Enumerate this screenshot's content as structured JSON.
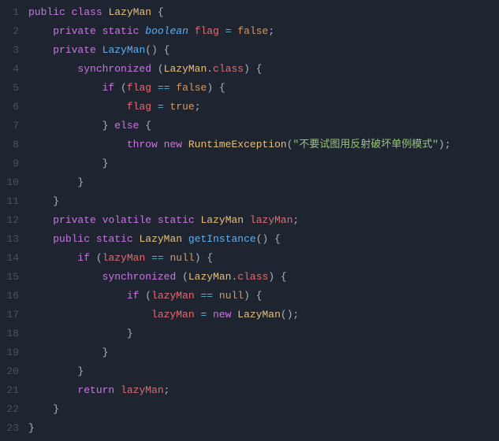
{
  "code": {
    "lines": [
      {
        "num": "1",
        "indent": 0,
        "tokens": [
          [
            "kw-mod",
            "public"
          ],
          [
            "sp",
            " "
          ],
          [
            "kw-mod",
            "class"
          ],
          [
            "sp",
            " "
          ],
          [
            "cls",
            "LazyMan"
          ],
          [
            "sp",
            " "
          ],
          [
            "punc",
            "{"
          ]
        ]
      },
      {
        "num": "2",
        "indent": 1,
        "tokens": [
          [
            "kw-mod",
            "private"
          ],
          [
            "sp",
            " "
          ],
          [
            "kw-mod",
            "static"
          ],
          [
            "sp",
            " "
          ],
          [
            "kw-type",
            "boolean"
          ],
          [
            "sp",
            " "
          ],
          [
            "id",
            "flag"
          ],
          [
            "sp",
            " "
          ],
          [
            "op",
            "="
          ],
          [
            "sp",
            " "
          ],
          [
            "kw-bool",
            "false"
          ],
          [
            "punc",
            ";"
          ]
        ]
      },
      {
        "num": "3",
        "indent": 1,
        "tokens": [
          [
            "kw-mod",
            "private"
          ],
          [
            "sp",
            " "
          ],
          [
            "fn",
            "LazyMan"
          ],
          [
            "punc",
            "()"
          ],
          [
            "sp",
            " "
          ],
          [
            "punc",
            "{"
          ]
        ]
      },
      {
        "num": "4",
        "indent": 2,
        "tokens": [
          [
            "kw-ctrl",
            "synchronized"
          ],
          [
            "sp",
            " "
          ],
          [
            "punc",
            "("
          ],
          [
            "cls",
            "LazyMan"
          ],
          [
            "punc",
            "."
          ],
          [
            "prop",
            "class"
          ],
          [
            "punc",
            ")"
          ],
          [
            "sp",
            " "
          ],
          [
            "punc",
            "{"
          ]
        ]
      },
      {
        "num": "5",
        "indent": 3,
        "tokens": [
          [
            "kw-ctrl",
            "if"
          ],
          [
            "sp",
            " "
          ],
          [
            "punc",
            "("
          ],
          [
            "id",
            "flag"
          ],
          [
            "sp",
            " "
          ],
          [
            "op",
            "=="
          ],
          [
            "sp",
            " "
          ],
          [
            "kw-bool",
            "false"
          ],
          [
            "punc",
            ")"
          ],
          [
            "sp",
            " "
          ],
          [
            "punc",
            "{"
          ]
        ]
      },
      {
        "num": "6",
        "indent": 4,
        "tokens": [
          [
            "id",
            "flag"
          ],
          [
            "sp",
            " "
          ],
          [
            "op",
            "="
          ],
          [
            "sp",
            " "
          ],
          [
            "kw-bool",
            "true"
          ],
          [
            "punc",
            ";"
          ]
        ]
      },
      {
        "num": "7",
        "indent": 3,
        "tokens": [
          [
            "punc",
            "}"
          ],
          [
            "sp",
            " "
          ],
          [
            "kw-ctrl",
            "else"
          ],
          [
            "sp",
            " "
          ],
          [
            "punc",
            "{"
          ]
        ]
      },
      {
        "num": "8",
        "indent": 4,
        "tokens": [
          [
            "kw-ctrl",
            "throw"
          ],
          [
            "sp",
            " "
          ],
          [
            "kw-new",
            "new"
          ],
          [
            "sp",
            " "
          ],
          [
            "cls",
            "RuntimeException"
          ],
          [
            "punc",
            "("
          ],
          [
            "str",
            "\"不要试图用反射破坏单例模式\""
          ],
          [
            "punc",
            ")"
          ],
          [
            "punc",
            ";"
          ]
        ]
      },
      {
        "num": "9",
        "indent": 3,
        "tokens": [
          [
            "punc",
            "}"
          ]
        ]
      },
      {
        "num": "10",
        "indent": 2,
        "tokens": [
          [
            "punc",
            "}"
          ]
        ]
      },
      {
        "num": "11",
        "indent": 1,
        "tokens": [
          [
            "punc",
            "}"
          ]
        ]
      },
      {
        "num": "12",
        "indent": 1,
        "tokens": [
          [
            "kw-mod",
            "private"
          ],
          [
            "sp",
            " "
          ],
          [
            "kw-mod",
            "volatile"
          ],
          [
            "sp",
            " "
          ],
          [
            "kw-mod",
            "static"
          ],
          [
            "sp",
            " "
          ],
          [
            "cls",
            "LazyMan"
          ],
          [
            "sp",
            " "
          ],
          [
            "id",
            "lazyMan"
          ],
          [
            "punc",
            ";"
          ]
        ]
      },
      {
        "num": "13",
        "indent": 1,
        "tokens": [
          [
            "kw-mod",
            "public"
          ],
          [
            "sp",
            " "
          ],
          [
            "kw-mod",
            "static"
          ],
          [
            "sp",
            " "
          ],
          [
            "cls",
            "LazyMan"
          ],
          [
            "sp",
            " "
          ],
          [
            "fn",
            "getInstance"
          ],
          [
            "punc",
            "()"
          ],
          [
            "sp",
            " "
          ],
          [
            "punc",
            "{"
          ]
        ]
      },
      {
        "num": "14",
        "indent": 2,
        "tokens": [
          [
            "kw-ctrl",
            "if"
          ],
          [
            "sp",
            " "
          ],
          [
            "punc",
            "("
          ],
          [
            "id",
            "lazyMan"
          ],
          [
            "sp",
            " "
          ],
          [
            "op",
            "=="
          ],
          [
            "sp",
            " "
          ],
          [
            "kw-bool",
            "null"
          ],
          [
            "punc",
            ")"
          ],
          [
            "sp",
            " "
          ],
          [
            "punc",
            "{"
          ]
        ]
      },
      {
        "num": "15",
        "indent": 3,
        "tokens": [
          [
            "kw-ctrl",
            "synchronized"
          ],
          [
            "sp",
            " "
          ],
          [
            "punc",
            "("
          ],
          [
            "cls",
            "LazyMan"
          ],
          [
            "punc",
            "."
          ],
          [
            "prop",
            "class"
          ],
          [
            "punc",
            ")"
          ],
          [
            "sp",
            " "
          ],
          [
            "punc",
            "{"
          ]
        ]
      },
      {
        "num": "16",
        "indent": 4,
        "tokens": [
          [
            "kw-ctrl",
            "if"
          ],
          [
            "sp",
            " "
          ],
          [
            "punc",
            "("
          ],
          [
            "id",
            "lazyMan"
          ],
          [
            "sp",
            " "
          ],
          [
            "op",
            "=="
          ],
          [
            "sp",
            " "
          ],
          [
            "kw-bool",
            "null"
          ],
          [
            "punc",
            ")"
          ],
          [
            "sp",
            " "
          ],
          [
            "punc",
            "{"
          ]
        ]
      },
      {
        "num": "17",
        "indent": 5,
        "tokens": [
          [
            "id",
            "lazyMan"
          ],
          [
            "sp",
            " "
          ],
          [
            "op",
            "="
          ],
          [
            "sp",
            " "
          ],
          [
            "kw-new",
            "new"
          ],
          [
            "sp",
            " "
          ],
          [
            "cls",
            "LazyMan"
          ],
          [
            "punc",
            "()"
          ],
          [
            "punc",
            ";"
          ]
        ]
      },
      {
        "num": "18",
        "indent": 4,
        "tokens": [
          [
            "punc",
            "}"
          ]
        ]
      },
      {
        "num": "19",
        "indent": 3,
        "tokens": [
          [
            "punc",
            "}"
          ]
        ]
      },
      {
        "num": "20",
        "indent": 2,
        "tokens": [
          [
            "punc",
            "}"
          ]
        ]
      },
      {
        "num": "21",
        "indent": 2,
        "tokens": [
          [
            "kw-ctrl",
            "return"
          ],
          [
            "sp",
            " "
          ],
          [
            "id",
            "lazyMan"
          ],
          [
            "punc",
            ";"
          ]
        ]
      },
      {
        "num": "22",
        "indent": 1,
        "tokens": [
          [
            "punc",
            "}"
          ]
        ]
      },
      {
        "num": "23",
        "indent": 0,
        "tokens": [
          [
            "punc",
            "}"
          ]
        ]
      }
    ],
    "indentUnit": "    "
  }
}
